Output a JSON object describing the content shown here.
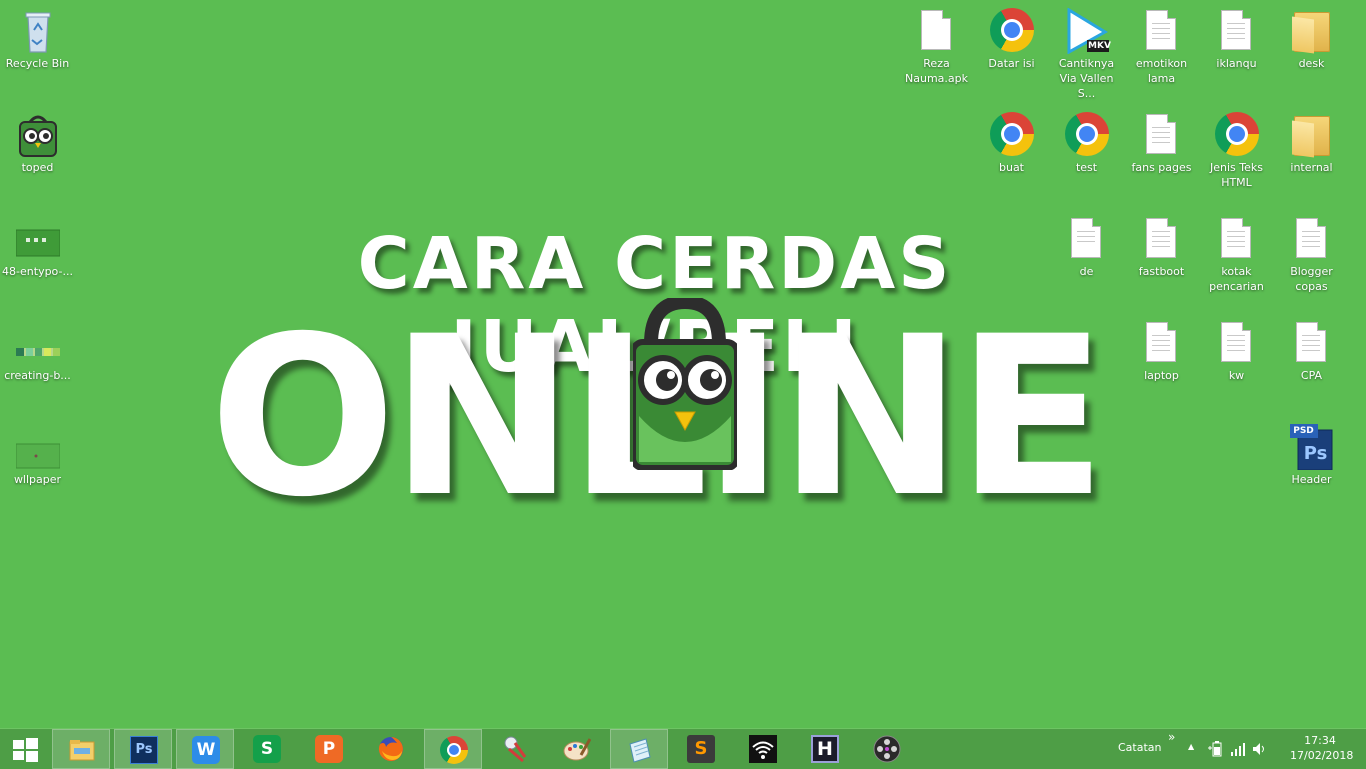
{
  "desktop": {
    "headline_line1": "CARA CERDAS JUAL/BELI",
    "headline_line2": "ONLINE",
    "left_icons": [
      {
        "label": "Recycle Bin",
        "icon": "recycle-bin-icon"
      },
      {
        "label": "toped",
        "icon": "tokopedia-icon"
      },
      {
        "label": "48-entypo-...",
        "icon": "image-thumbnail-icon"
      },
      {
        "label": "creating-b...",
        "icon": "image-thumbnail-icon"
      },
      {
        "label": "wllpaper",
        "icon": "image-thumbnail-icon"
      }
    ],
    "right_icons": [
      {
        "label": "Reza Nauma.apk",
        "icon": "document-icon"
      },
      {
        "label": "Datar isi",
        "icon": "chrome-icon"
      },
      {
        "label": "Cantiknya Via Vallen S...",
        "icon": "mkv-video-icon",
        "badge": "MKV"
      },
      {
        "label": "emotikon lama",
        "icon": "document-icon"
      },
      {
        "label": "iklanqu",
        "icon": "document-icon"
      },
      {
        "label": "desk",
        "icon": "folder-icon"
      },
      {
        "label": "buat",
        "icon": "chrome-icon"
      },
      {
        "label": "test",
        "icon": "chrome-icon"
      },
      {
        "label": "fans pages",
        "icon": "document-icon"
      },
      {
        "label": "Jenis Teks HTML",
        "icon": "chrome-icon"
      },
      {
        "label": "internal",
        "icon": "folder-icon"
      },
      {
        "label": "de",
        "icon": "document-icon"
      },
      {
        "label": "fastboot",
        "icon": "document-icon"
      },
      {
        "label": "kotak pencarian",
        "icon": "document-icon"
      },
      {
        "label": "Blogger copas",
        "icon": "document-icon"
      },
      {
        "label": "laptop",
        "icon": "document-icon"
      },
      {
        "label": "kw",
        "icon": "document-icon"
      },
      {
        "label": "CPA",
        "icon": "document-icon"
      },
      {
        "label": "Header",
        "icon": "photoshop-psd-icon",
        "badge": "PSD",
        "badge2": "Ps"
      }
    ]
  },
  "taskbar": {
    "apps": [
      {
        "name": "file-explorer",
        "icon": "folder-icon"
      },
      {
        "name": "photoshop",
        "icon": "photoshop-icon",
        "text": "Ps"
      },
      {
        "name": "wps-writer",
        "icon": "wps-writer-icon",
        "text": "W"
      },
      {
        "name": "wps-spreadsheet",
        "icon": "wps-spreadsheet-icon",
        "text": "S"
      },
      {
        "name": "wps-presentation",
        "icon": "wps-presentation-icon",
        "text": "P"
      },
      {
        "name": "firefox",
        "icon": "firefox-icon"
      },
      {
        "name": "chrome",
        "icon": "chrome-icon"
      },
      {
        "name": "snipping-tool",
        "icon": "snipping-tool-icon"
      },
      {
        "name": "paint",
        "icon": "paint-icon"
      },
      {
        "name": "notepad",
        "icon": "notepad-icon"
      },
      {
        "name": "sublime-text",
        "icon": "sublime-text-icon",
        "text": "S"
      },
      {
        "name": "wifi-app",
        "icon": "wifi-icon"
      },
      {
        "name": "h-app",
        "icon": "h-app-icon",
        "text": "H"
      },
      {
        "name": "video-app",
        "icon": "film-reel-icon"
      }
    ],
    "toolbar_label": "Catatan",
    "toolbar_chevron": "»",
    "tray_up_arrow": "▲",
    "time": "17:34",
    "date": "17/02/2018"
  }
}
